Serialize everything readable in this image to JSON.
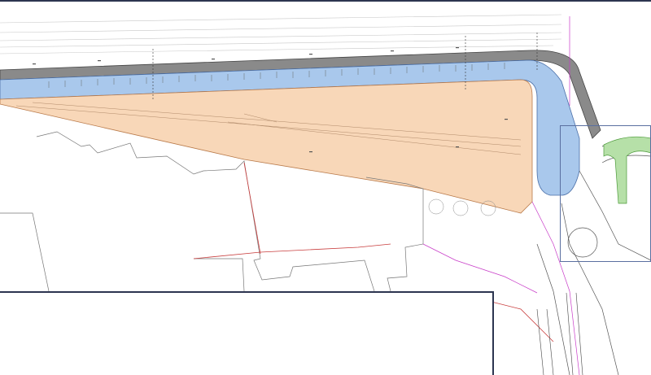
{
  "drawing": {
    "colors": {
      "frame": "#2c3550",
      "building_plot": "#f8d7b8",
      "water_area": "#a9c8ec",
      "road_edge": "#555555",
      "green_area": "#8cc97a",
      "pipe_line": "#c83c3c",
      "boundary_line": "#c83cc8"
    }
  }
}
